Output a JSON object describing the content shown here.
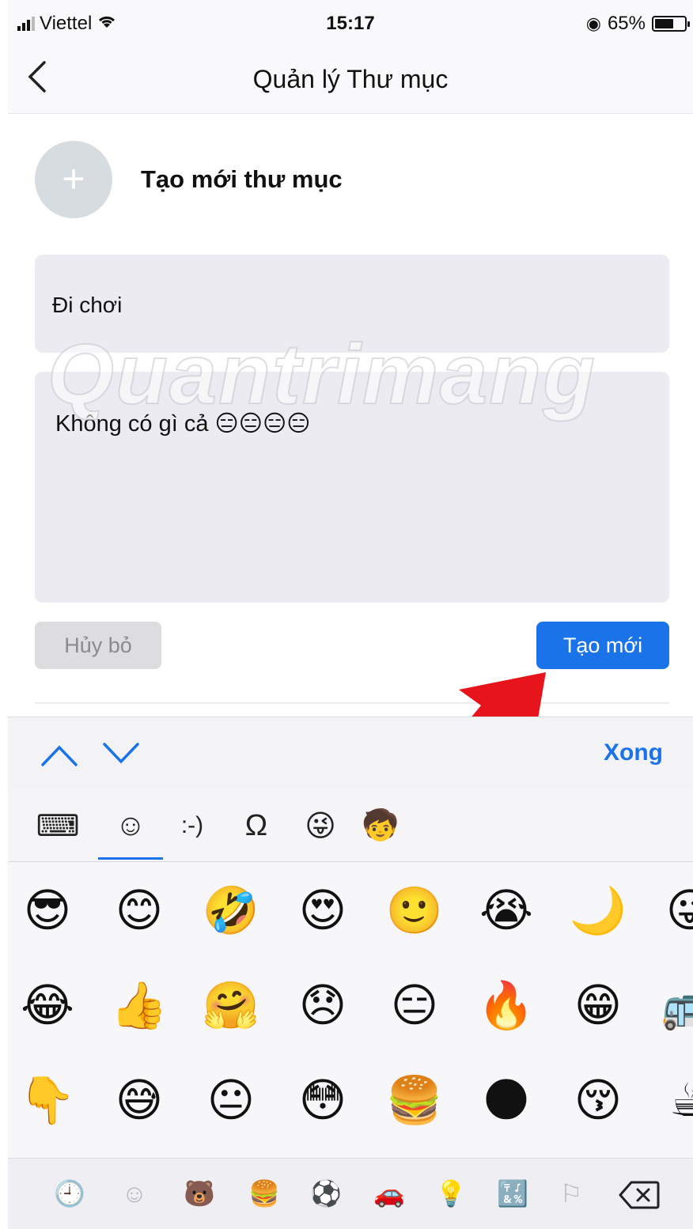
{
  "status_bar": {
    "carrier": "Viettel",
    "time": "15:17",
    "battery": "65%",
    "battery_level": 0.65
  },
  "nav": {
    "title": "Quản lý Thư mục",
    "back_icon": "chevron-left-icon"
  },
  "create": {
    "label": "Tạo mới thư mục",
    "plus": "+"
  },
  "form": {
    "name_value": "Đi chơi",
    "description_value": "Không có gì cả 😑😑😑😑"
  },
  "watermark": "Quantrimang",
  "buttons": {
    "cancel": "Hủy bỏ",
    "create": "Tạo mới"
  },
  "colors": {
    "accent": "#1a73e8",
    "arrow": "#e8141c"
  },
  "keyboard_toolbar": {
    "done": "Xong"
  },
  "keyboard_tabs": [
    {
      "name": "keyboard-icon",
      "glyph": "⌨"
    },
    {
      "name": "smiley-tab-icon",
      "glyph": "☺"
    },
    {
      "name": "text-emoticon-tab",
      "glyph": ":-)"
    },
    {
      "name": "symbols-omega-icon",
      "glyph": "Ω"
    },
    {
      "name": "sticker-face-icon",
      "glyph": "😜"
    },
    {
      "name": "avatar-sticker-icon",
      "glyph": "🧒"
    }
  ],
  "emoji_rows": [
    [
      "😎",
      "😊",
      "🤣",
      "😍",
      "🙂",
      "😭",
      "🌙",
      "😜"
    ],
    [
      "😂",
      "👍",
      "🤗",
      "😞",
      "😑",
      "🔥",
      "😁",
      "🚌"
    ],
    [
      "👇",
      "😅",
      "😐",
      "😳",
      "🍔",
      "🌑",
      "😚",
      "☕"
    ]
  ],
  "emoji_categories": [
    {
      "name": "recent-clock-icon",
      "glyph": "🕘"
    },
    {
      "name": "smileys-category-icon",
      "glyph": "☺"
    },
    {
      "name": "animals-category-icon",
      "glyph": "🐻"
    },
    {
      "name": "food-category-icon",
      "glyph": "🍔"
    },
    {
      "name": "activity-category-icon",
      "glyph": "⚽"
    },
    {
      "name": "travel-category-icon",
      "glyph": "🚗"
    },
    {
      "name": "objects-category-icon",
      "glyph": "💡"
    },
    {
      "name": "symbols-category-icon",
      "glyph": "🔣"
    },
    {
      "name": "flags-category-icon",
      "glyph": "⚐"
    }
  ]
}
